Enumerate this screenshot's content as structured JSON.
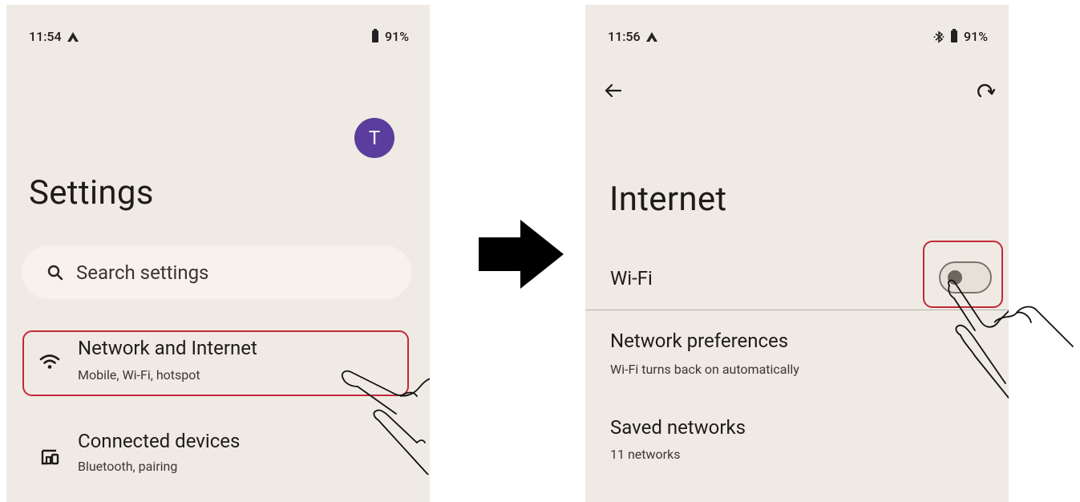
{
  "left_screen": {
    "status": {
      "time": "11:54",
      "battery": "91%"
    },
    "avatar_initial": "T",
    "title": "Settings",
    "search": {
      "placeholder": "Search settings"
    },
    "items": [
      {
        "title": "Network and Internet",
        "subtitle": "Mobile, Wi-Fi, hotspot",
        "icon": "wifi-icon"
      },
      {
        "title": "Connected devices",
        "subtitle": "Bluetooth, pairing",
        "icon": "connected-devices-icon"
      }
    ]
  },
  "right_screen": {
    "status": {
      "time": "11:56",
      "battery": "91%"
    },
    "title": "Internet",
    "wifi": {
      "label": "Wi-Fi",
      "enabled": false
    },
    "items": [
      {
        "title": "Network preferences",
        "subtitle": "Wi-Fi turns back on automatically"
      },
      {
        "title": "Saved networks",
        "subtitle": "11 networks"
      }
    ]
  },
  "colors": {
    "screen_bg": "#efeae4",
    "highlight": "#c3283a",
    "avatar": "#5a3d9c"
  }
}
